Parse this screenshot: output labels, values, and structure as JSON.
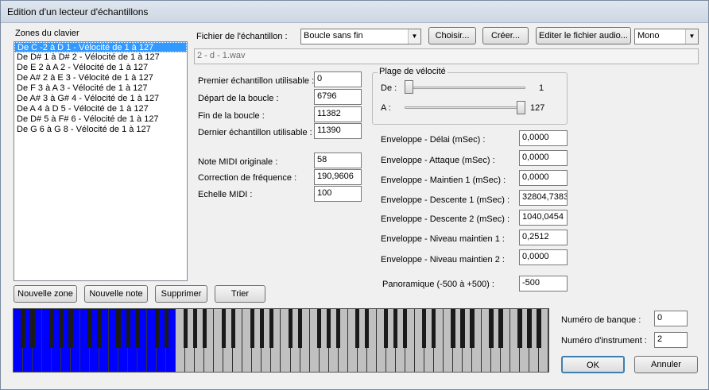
{
  "window": {
    "title": "Edition d'un lecteur d'échantillons"
  },
  "zones": {
    "label": "Zones du clavier",
    "items": [
      "De C -2 à D 1 - Vélocité de 1 à 127",
      "De D# 1 à D# 2 - Vélocité de 1 à 127",
      "De E 2 à A 2 - Vélocité de 1 à 127",
      "De A# 2 à E 3 - Vélocité de 1 à 127",
      "De F 3 à A 3 - Vélocité de 1 à 127",
      "De A# 3 à G# 4 - Vélocité de 1 à 127",
      "De A 4 à D 5 - Vélocité de 1 à 127",
      "De D# 5 à F# 6 - Vélocité de 1 à 127",
      "De G 6 à G 8 - Vélocité de 1 à 127"
    ],
    "selected_index": 0
  },
  "file": {
    "label": "Fichier de l'échantillon :",
    "loop_mode": "Boucle sans fin",
    "choose_label": "Choisir...",
    "create_label": "Créer...",
    "edit_label": "Editer le fichier audio...",
    "channel": "Mono",
    "path": "2 - d - 1.wav"
  },
  "sample": {
    "first_label": "Premier échantillon utilisable :",
    "first_value": "0",
    "loop_start_label": "Départ de la boucle :",
    "loop_start_value": "6796",
    "loop_end_label": "Fin de la boucle :",
    "loop_end_value": "11382",
    "last_label": "Dernier échantillon utilisable :",
    "last_value": "11390",
    "midi_note_label": "Note MIDI originale :",
    "midi_note_value": "58",
    "freq_label": "Correction de fréquence :",
    "freq_value": "190,9606",
    "midi_scale_label": "Echelle MIDI :",
    "midi_scale_value": "100"
  },
  "velocity": {
    "title": "Plage de vélocité",
    "from_label": "De :",
    "from_value": "1",
    "to_label": "A :",
    "to_value": "127",
    "range_min": 1,
    "range_max": 127
  },
  "envelope": {
    "delay_label": "Enveloppe - Délai (mSec) :",
    "delay_value": "0,0000",
    "attack_label": "Enveloppe - Attaque (mSec) :",
    "attack_value": "0,0000",
    "hold_label": "Enveloppe - Maintien 1 (mSec) :",
    "hold_value": "0,0000",
    "decay1_label": "Enveloppe - Descente 1 (mSec) :",
    "decay1_value": "32804,7383",
    "decay2_label": "Enveloppe - Descente 2 (mSec) :",
    "decay2_value": "1040,0454",
    "sustain1_label": "Enveloppe - Niveau maintien 1 :",
    "sustain1_value": "0,2512",
    "sustain2_label": "Enveloppe - Niveau maintien 2 :",
    "sustain2_value": "0,0000",
    "pan_label": "Panoramique (-500 à +500) :",
    "pan_value": "-500"
  },
  "buttons": {
    "new_zone": "Nouvelle zone",
    "new_note": "Nouvelle note",
    "delete": "Supprimer",
    "sort": "Trier",
    "ok": "OK",
    "cancel": "Annuler"
  },
  "bank": {
    "bank_label": "Numéro de banque :",
    "bank_value": "0",
    "instrument_label": "Numéro d'instrument :",
    "instrument_value": "2"
  },
  "keyboard": {
    "white_keys": 56,
    "highlighted_white_keys": 17,
    "highlight_color": "#0000ff",
    "key_color": "#c0c0c0"
  }
}
